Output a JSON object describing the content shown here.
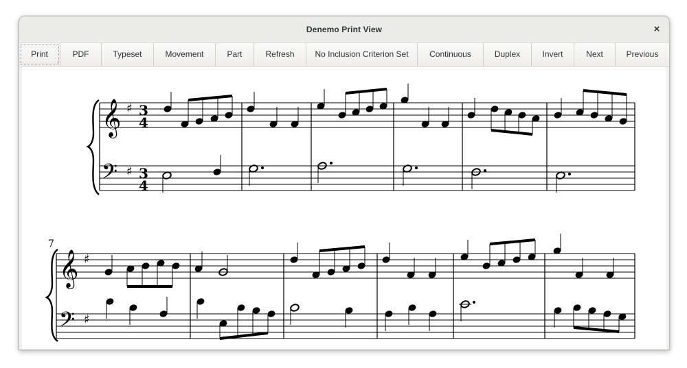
{
  "window": {
    "title": "Denemo Print View",
    "close_symbol": "×"
  },
  "toolbar": {
    "buttons": [
      {
        "label": "Print"
      },
      {
        "label": "PDF"
      },
      {
        "label": "Typeset"
      },
      {
        "label": "Movement"
      },
      {
        "label": "Part"
      },
      {
        "label": "Refresh"
      },
      {
        "label": "No Inclusion Criterion Set"
      },
      {
        "label": "Continuous"
      },
      {
        "label": "Duplex"
      },
      {
        "label": "Invert"
      },
      {
        "label": "Next"
      },
      {
        "label": "Previous"
      }
    ]
  },
  "score": {
    "key_signature": "G major (one sharp)",
    "time_signature": "3/4",
    "second_system_measure_number": "7",
    "icons": [
      "treble-clef-icon",
      "bass-clef-icon",
      "sharp-icon",
      "brace-icon"
    ]
  }
}
